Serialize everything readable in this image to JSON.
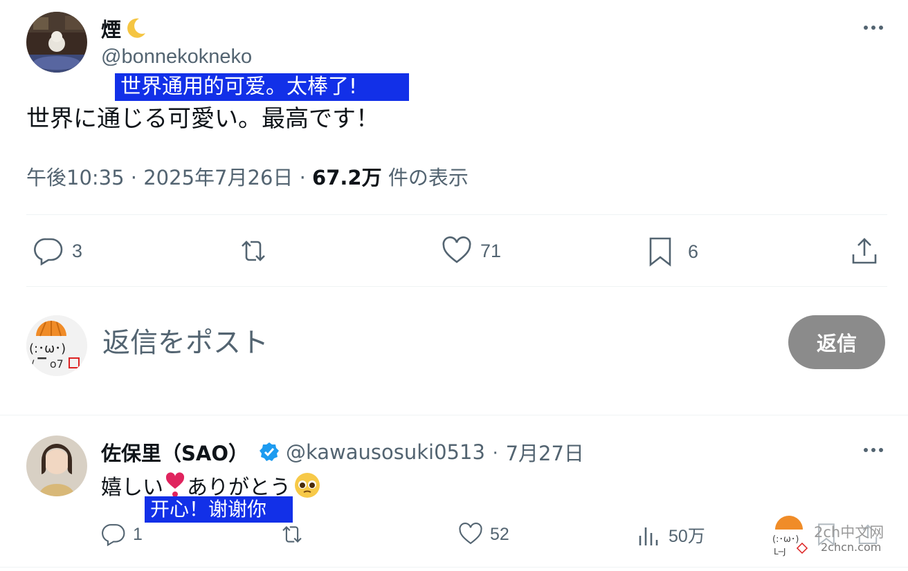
{
  "main_tweet": {
    "display_name": "煙",
    "name_emoji": "🌙",
    "handle": "@bonnekokneko",
    "subtitle_cn": "世界通用的可爱。太棒了!",
    "text": "世界に通じる可愛い。最高です！",
    "time": "午後10:35",
    "date": "2025年7月26日",
    "views_count": "67.2万",
    "views_label": "件の表示",
    "separator": "·",
    "actions": {
      "reply_count": "3",
      "retweet_count": "",
      "like_count": "71",
      "bookmark_count": "6"
    }
  },
  "reply_box": {
    "placeholder": "返信をポスト",
    "button_label": "返信"
  },
  "reply_tweet": {
    "display_name": "佐保里（SAO）",
    "handle": "@kawausosuki0513",
    "date": "7月27日",
    "separator": "·",
    "text_before": "嬉しい",
    "heart_emoji": "❣️",
    "text_after": "ありがとう",
    "face_emoji": "🥺",
    "subtitle_cn": "开心！谢谢你",
    "actions": {
      "reply_count": "1",
      "retweet_count": "",
      "like_count": "52",
      "views_count": "50万"
    }
  },
  "watermark": {
    "title": "2ch中文网",
    "url": "2chcn.com"
  },
  "colors": {
    "text": "#0f1419",
    "secondary": "#536471",
    "subtitle_bg": "#1230e8",
    "verified": "#1d9bf0",
    "reply_button": "#8b8b8b"
  }
}
